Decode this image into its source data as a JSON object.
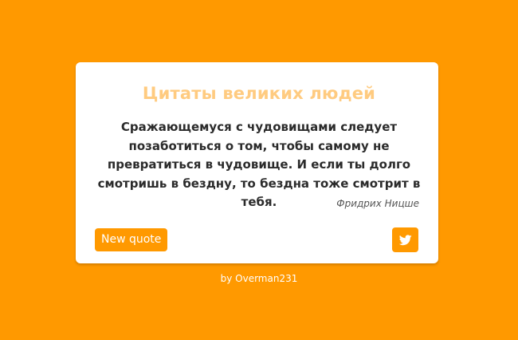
{
  "colors": {
    "background": "#ff9900",
    "card": "#ffffff",
    "title": "#ffcb80",
    "button": "#ff9900"
  },
  "card": {
    "title": "Цитаты великих людей",
    "quote": "Сражающемуся с чудовищами следует позаботиться о том, чтобы самому не превратиться в чудовище. И если ты долго смотришь в бездну, то бездна тоже смотрит в тебя.",
    "author": "Фридрих Ницше",
    "new_quote_label": "New quote",
    "tweet_icon": "twitter-icon"
  },
  "footer": {
    "credit": "by Overman231"
  }
}
